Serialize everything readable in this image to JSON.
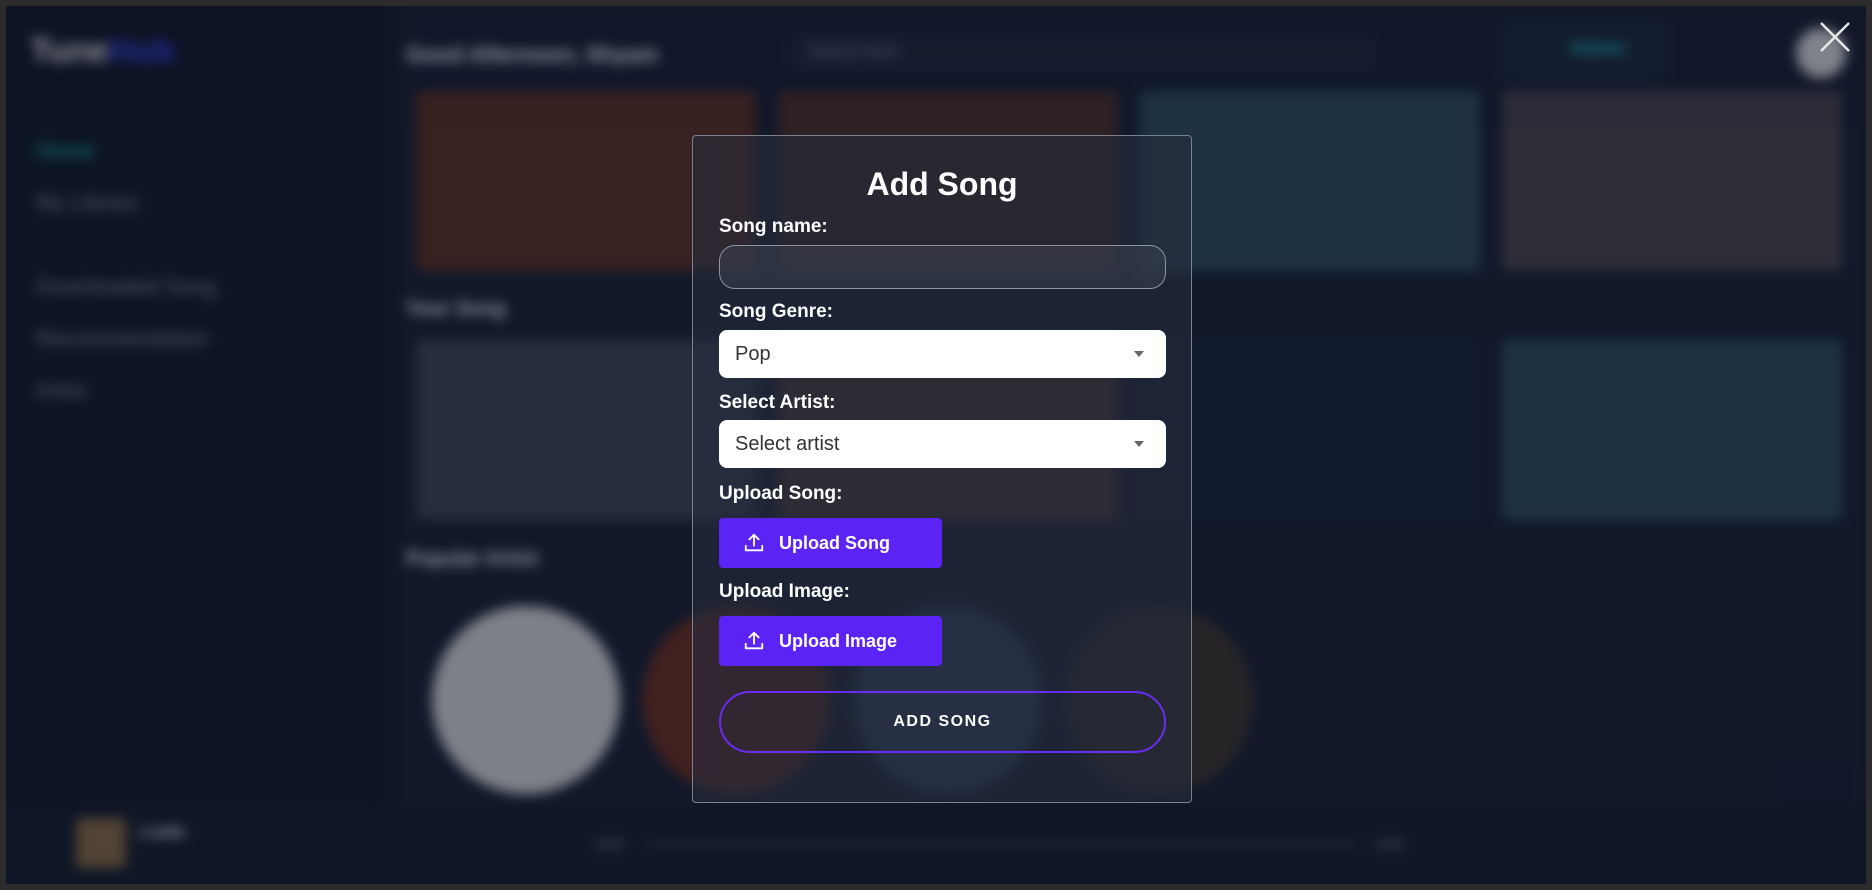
{
  "background": {
    "logo_part1": "Tune",
    "logo_part2": "Hub",
    "nav": [
      "Home",
      "My Library",
      "Downloaded Song",
      "Recommendation",
      "Artist"
    ],
    "greeting": "Good Afternoon, Shyam",
    "search_placeholder": "Search Here",
    "admin_label": "Admin",
    "sections": [
      "Your Song",
      "Popular Artist"
    ],
    "track_title": "Lvalie",
    "time_start": "0:00",
    "time_end": "0:00"
  },
  "modal": {
    "title": "Add Song",
    "song_name_label": "Song name:",
    "song_name_value": "",
    "genre_label": "Song Genre:",
    "genre_value": "Pop",
    "artist_label": "Select Artist:",
    "artist_value": "Select artist",
    "upload_song_label": "Upload Song:",
    "upload_song_button": "Upload Song",
    "upload_image_label": "Upload Image:",
    "upload_image_button": "Upload Image",
    "submit_button": "ADD SONG"
  },
  "colors": {
    "accent": "#5b24f5",
    "teal": "#14c8c8",
    "bg": "#0f1626"
  },
  "icons": [
    "upload-icon",
    "close-icon",
    "chevron-down-icon"
  ]
}
